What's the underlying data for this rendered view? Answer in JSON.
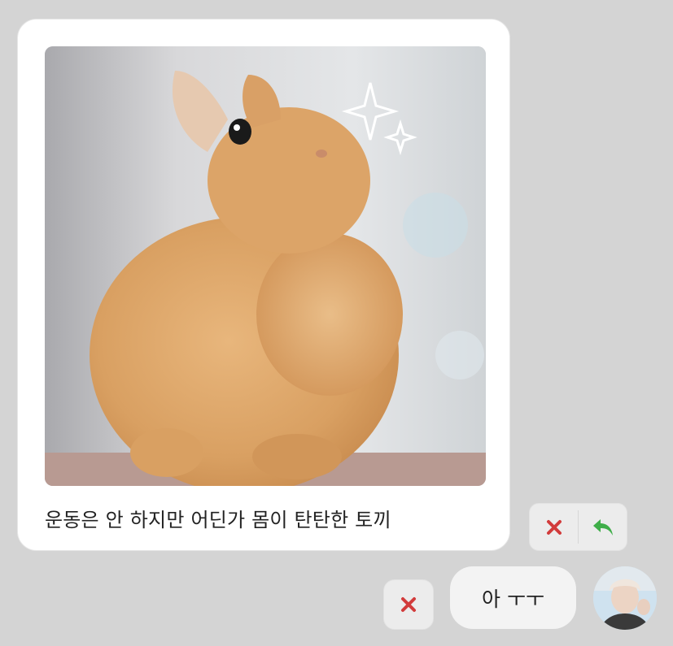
{
  "message": {
    "image_alt": "운동은 안 하지만 어딘가 몸이 탄탄한 토끼",
    "caption": "운동은 안 하지만 어딘가 몸이 탄탄한 토끼"
  },
  "actions": {
    "reject_icon": "close-icon",
    "reply_icon": "reply-arrow-icon",
    "reject_color": "#d23b3b",
    "reply_color": "#3fae49"
  },
  "reply": {
    "text": "아 ㅜㅜ",
    "reject_icon": "close-icon"
  },
  "colors": {
    "background": "#d4d4d4",
    "card": "#ffffff",
    "button": "#ececec"
  }
}
